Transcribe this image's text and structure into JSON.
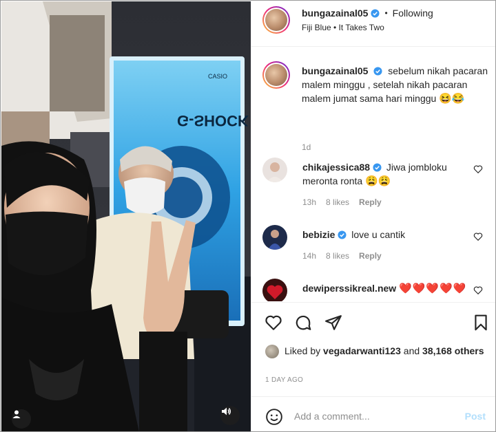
{
  "header": {
    "username": "bungazainal05",
    "follow_status": "Following",
    "separator": "•",
    "audio": "Fiji Blue • It Takes Two"
  },
  "caption": {
    "username": "bungazainal05",
    "text": "sebelum nikah pacaran malem minggu , setelah nikah pacaran malem jumat sama hari minggu",
    "emojis": "😆😂",
    "time": "1d"
  },
  "comments": [
    {
      "username": "chikajessica88",
      "text": "Jiwa jombloku meronta ronta",
      "emojis": "😩😩",
      "time": "13h",
      "likes": "8 likes",
      "reply": "Reply"
    },
    {
      "username": "bebizie",
      "text": "love u cantik",
      "emojis": "",
      "time": "14h",
      "likes": "8 likes",
      "reply": "Reply"
    },
    {
      "username": "dewiperssikreal.new",
      "text": "",
      "hearts": "❤️❤️❤️❤️❤️"
    }
  ],
  "likes": {
    "prefix": "Liked by",
    "user": "vegadarwanti123",
    "and": "and",
    "others": "38,168 others"
  },
  "post_date": "1 DAY AGO",
  "add_comment": {
    "placeholder": "Add a comment...",
    "post_label": "Post"
  },
  "video": {
    "sign_text": "G-SHOCK",
    "sign_brand": "CASIO"
  },
  "colors": {
    "verified": "#3897f0",
    "link": "#0095f6",
    "heart": "#ed4956",
    "muted": "#8e8e8e",
    "post_disabled": "#b2dffc"
  }
}
